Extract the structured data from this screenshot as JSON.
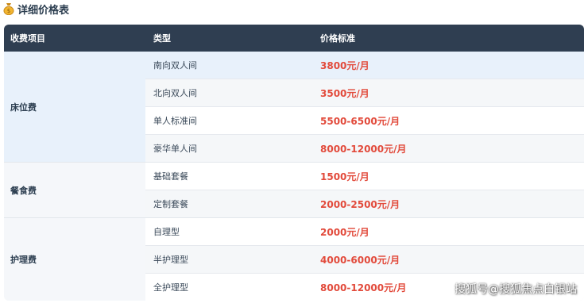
{
  "heading": {
    "title": "详细价格表",
    "icon": "money-bag-icon"
  },
  "table": {
    "headers": [
      "收费项目",
      "类型",
      "价格标准"
    ],
    "groups": [
      {
        "category": "床位费",
        "rows": [
          {
            "type": "南向双人间",
            "price": "3800元/月"
          },
          {
            "type": "北向双人间",
            "price": "3500元/月"
          },
          {
            "type": "单人标准间",
            "price": "5500-6500元/月"
          },
          {
            "type": "豪华单人间",
            "price": "8000-12000元/月"
          }
        ]
      },
      {
        "category": "餐食费",
        "rows": [
          {
            "type": "基础套餐",
            "price": "1500元/月"
          },
          {
            "type": "定制套餐",
            "price": "2000-2500元/月"
          }
        ]
      },
      {
        "category": "护理费",
        "rows": [
          {
            "type": "自理型",
            "price": "2000元/月"
          },
          {
            "type": "半护理型",
            "price": "4000-6000元/月"
          },
          {
            "type": "全护理型",
            "price": "8000-12000元/月"
          }
        ]
      }
    ]
  },
  "watermark": "搜狐号@搜狐焦点白银站",
  "colors": {
    "header_bg": "#2f3e51",
    "price_text": "#e24a3b",
    "highlight_row": "#e8f1fb"
  }
}
